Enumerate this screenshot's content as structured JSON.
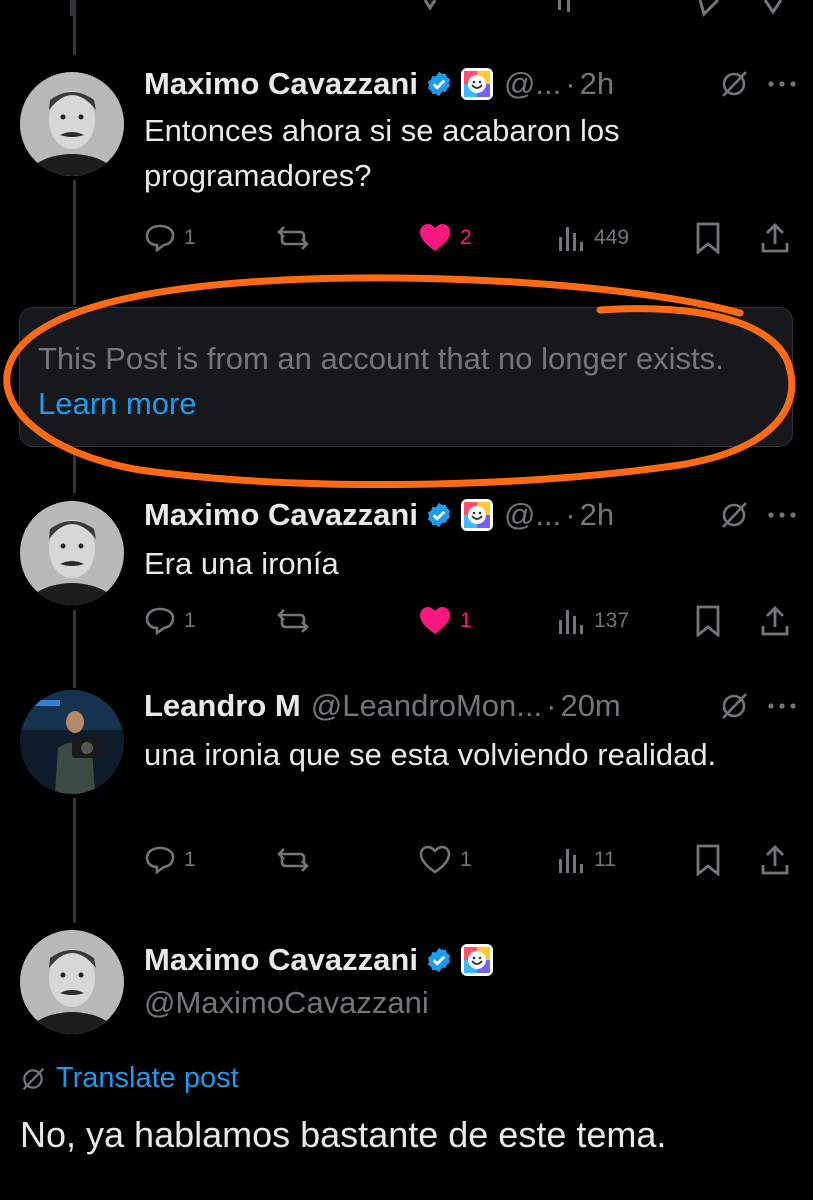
{
  "colors": {
    "background": "#000000",
    "text": "#e7e9ea",
    "muted": "#71767b",
    "like": "#f91880",
    "link": "#1d9bf0",
    "verified": "#1d9bf0",
    "annotation": "#ff6a13"
  },
  "replies": [
    {
      "name": "Maximo Cavazzani",
      "handle": "@...",
      "time": "2h",
      "text": "Entonces ahora si se acabaron los programadores?",
      "actions": {
        "replies": "1",
        "reposts": "",
        "likes": "2",
        "views": "449",
        "liked": true
      }
    },
    {
      "name": "Maximo Cavazzani",
      "handle": "@...",
      "time": "2h",
      "text": "Era una ironía",
      "actions": {
        "replies": "1",
        "reposts": "",
        "likes": "1",
        "views": "137",
        "liked": true
      }
    },
    {
      "name": "Leandro M",
      "handle": "@LeandroMon...",
      "time": "20m",
      "text": "una ironia que se esta volviendo realidad.",
      "actions": {
        "replies": "1",
        "reposts": "",
        "likes": "1",
        "views": "11",
        "liked": false
      }
    }
  ],
  "tombstone": {
    "text": "This Post is from an account that no longer exists.",
    "link": "Learn more"
  },
  "main_post": {
    "name": "Maximo Cavazzani",
    "handle": "@MaximoCavazzani",
    "translate": "Translate post",
    "text": "No, ya hablamos bastante de este tema."
  },
  "icons": {
    "verified": "verified-badge-icon",
    "affiliate": "affiliate-logo-icon",
    "grok": "grok-icon",
    "more": "more-icon",
    "reply": "reply-icon",
    "repost": "repost-icon",
    "like": "heart-icon",
    "views": "views-icon",
    "bookmark": "bookmark-icon",
    "share": "share-icon",
    "translate": "translate-icon"
  }
}
